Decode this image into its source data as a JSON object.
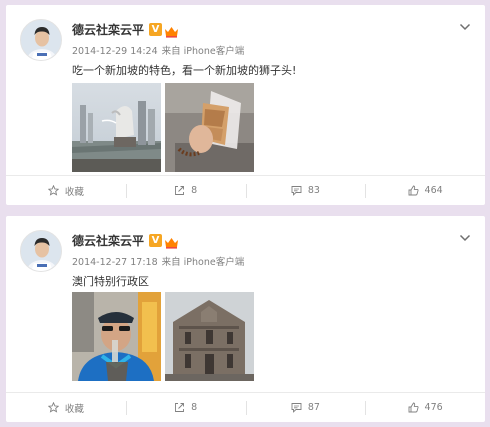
{
  "colors": {
    "background": "#e9dfee",
    "card": "#ffffff",
    "name_text": "#333333",
    "meta_text": "#808080",
    "vip_badge": "#f6a623",
    "crown_badge": "#ff8200"
  },
  "posts": [
    {
      "author": "德云社栾云平",
      "badges": [
        "verified-v-badge",
        "member-crown-badge"
      ],
      "timestamp": "2014-12-29 14:24",
      "source": "来自 iPhone客户端",
      "text": "吃一个新加坡的特色，看一个新加坡的狮子头!",
      "images": [
        "merlion-photo",
        "toast-snack-photo"
      ],
      "actions": {
        "favorite_label": "收藏",
        "repost_count": "8",
        "comment_count": "83",
        "like_count": "464"
      }
    },
    {
      "author": "德云社栾云平",
      "badges": [
        "verified-v-badge",
        "member-crown-badge"
      ],
      "timestamp": "2014-12-27 17:18",
      "source": "来自 iPhone客户端",
      "text": "澳门特别行政区",
      "images": [
        "selfie-drink-photo",
        "ruins-st-paul-photo"
      ],
      "actions": {
        "favorite_label": "收藏",
        "repost_count": "8",
        "comment_count": "87",
        "like_count": "476"
      }
    }
  ]
}
